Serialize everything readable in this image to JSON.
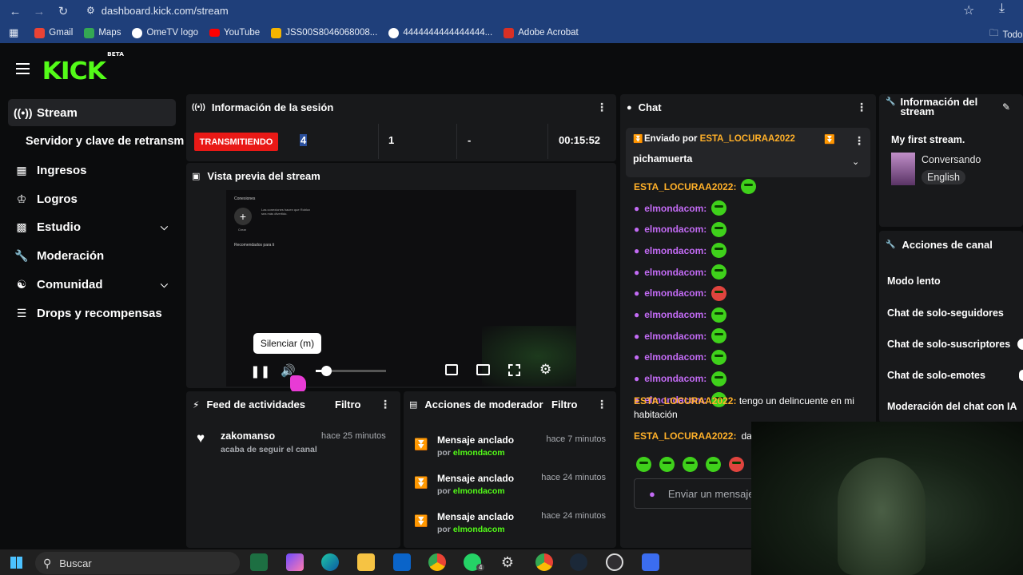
{
  "browser": {
    "url": "dashboard.kick.com/stream",
    "bookmarks": [
      "Gmail",
      "Maps",
      "OmeTV logo",
      "YouTube",
      "JSS00S8046068008...",
      "4444444444444444...",
      "Adobe Acrobat"
    ],
    "bookmark_colors": [
      "#ea4335",
      "#34a853",
      "#ffffff",
      "#ff0000",
      "#f4b400",
      "#ffffff",
      "#d93025"
    ],
    "folder_label": "Todo"
  },
  "brand": {
    "logo": "KICK",
    "badge": "BETA",
    "accent": "#53fc18"
  },
  "sidebar": {
    "items": [
      {
        "label": "Stream",
        "icon": "broadcast-icon",
        "active": true
      },
      {
        "label": "Servidor y clave de retransm",
        "icon": ""
      },
      {
        "label": "Ingresos",
        "icon": "revenue-icon"
      },
      {
        "label": "Logros",
        "icon": "trophy-icon"
      },
      {
        "label": "Estudio",
        "icon": "studio-icon",
        "expandable": true
      },
      {
        "label": "Moderación",
        "icon": "wrench-icon"
      },
      {
        "label": "Comunidad",
        "icon": "community-icon",
        "expandable": true
      },
      {
        "label": "Drops y recompensas",
        "icon": "drops-icon"
      }
    ]
  },
  "session": {
    "title": "Información de la sesión",
    "status": "TRANSMITIENDO",
    "status_color": "#e91916",
    "stats": [
      "4",
      "1",
      "-",
      "00:15:52"
    ]
  },
  "preview": {
    "title": "Vista previa del stream",
    "tooltip": "Silenciar (m)",
    "inner_texts": [
      "Conexiones",
      "Crear",
      "Las conexiones hacen que Roblox sea más divertido.",
      "Recomendados para ti"
    ],
    "volume": 0.15
  },
  "feed": {
    "title": "Feed de actividades",
    "filter": "Filtro",
    "items": [
      {
        "user": "zakomanso",
        "action": "acaba de seguir el canal",
        "time": "hace 25 minutos"
      }
    ]
  },
  "modactions": {
    "title": "Acciones de moderador",
    "filter": "Filtro",
    "items": [
      {
        "title": "Mensaje anclado",
        "by": "por",
        "user": "elmondacom",
        "time": "hace 7 minutos"
      },
      {
        "title": "Mensaje anclado",
        "by": "por",
        "user": "elmondacom",
        "time": "hace 24 minutos"
      },
      {
        "title": "Mensaje anclado",
        "by": "por",
        "user": "elmondacom",
        "time": "hace 24 minutos"
      }
    ]
  },
  "chat": {
    "title": "Chat",
    "pinned_prefix": "Enviado por",
    "pinned_user": "ESTA_LOCURAA2022",
    "pinned_message": "pichamuerta",
    "top_user": "ESTA_LOCURAA2022:",
    "mod_user": "elmondacom:",
    "mod_lines": 10,
    "msg1_user": "ESTA_LOCURAA2022:",
    "msg1_text": "tengo un delincuente en mi habitación",
    "msg2_user": "ESTA_LOCURAA2022:",
    "msg2_text": "dar",
    "input_placeholder": "Enviar un mensaje"
  },
  "info": {
    "title": "Información del stream",
    "stream_title": "My first stream.",
    "category": "Conversando",
    "language": "English"
  },
  "channel_actions": {
    "title": "Acciones de canal",
    "items": [
      "Modo lento",
      "Chat de solo-seguidores",
      "Chat de solo-suscriptores",
      "Chat de solo-emotes",
      "Moderación del chat con IA"
    ]
  },
  "taskbar": {
    "search": "Buscar",
    "badge": "4"
  }
}
